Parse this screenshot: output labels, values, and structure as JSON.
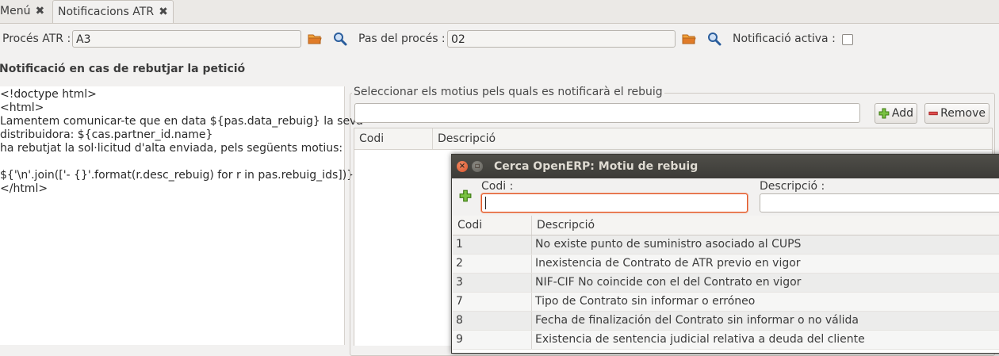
{
  "tabs": [
    {
      "label": "Menú"
    },
    {
      "label": "Notificacions ATR"
    }
  ],
  "form": {
    "proces_label": "Procés ATR :",
    "proces_value": "A3",
    "pas_label": "Pas del procés :",
    "pas_value": "02",
    "activa_label": "Notificació activa :",
    "activa_checked": false
  },
  "section": {
    "title": "Notificació en cas de rebutjar la petició"
  },
  "template_lines": [
    "<!doctype html>",
    "<html>",
    "Lamentem comunicar-te que en data ${pas.data_rebuig} la seva",
    "distribuidora: ${cas.partner_id.name}",
    "ha rebutjat la sol·licitud d'alta enviada, pels següents motius:",
    "",
    "${'\\n'.join(['- {}'.format(r.desc_rebuig) for r in pas.rebuig_ids])}",
    "</html>"
  ],
  "motius": {
    "frame_title": "Seleccionar els motius pels quals es notificarà el rebuig",
    "search_value": "",
    "add_label": "Add",
    "remove_label": "Remove",
    "columns": [
      "Codi",
      "Descripció"
    ]
  },
  "dialog": {
    "title": "Cerca OpenERP: Motiu de rebuig",
    "codi_label": "Codi :",
    "descripcio_label": "Descripció :",
    "codi_value": "",
    "descripcio_value": "",
    "columns": [
      "Codi",
      "Descripció"
    ],
    "rows": [
      {
        "codi": "1",
        "descripcio": "No existe punto de suministro asociado al CUPS"
      },
      {
        "codi": "2",
        "descripcio": "Inexistencia de Contrato de ATR previo en vigor"
      },
      {
        "codi": "3",
        "descripcio": "NIF-CIF No coincide con el del Contrato en vigor"
      },
      {
        "codi": "7",
        "descripcio": "Tipo de Contrato sin informar o erróneo"
      },
      {
        "codi": "8",
        "descripcio": "Fecha de finalización del Contrato sin informar o no válida"
      },
      {
        "codi": "9",
        "descripcio": "Existencia de sentencia judicial relativa a deuda del cliente"
      }
    ]
  },
  "icons": {
    "close": "close-icon",
    "folder": "folder-open-icon",
    "search": "search-icon",
    "add": "plus-icon",
    "remove": "minus-icon"
  },
  "colors": {
    "accent_orange": "#e0582b",
    "folder_orange": "#d9822b",
    "search_blue": "#2a5d9c",
    "add_green": "#4e9a06",
    "remove_red": "#cc3b3b",
    "titlebar": "#3c3b37"
  }
}
